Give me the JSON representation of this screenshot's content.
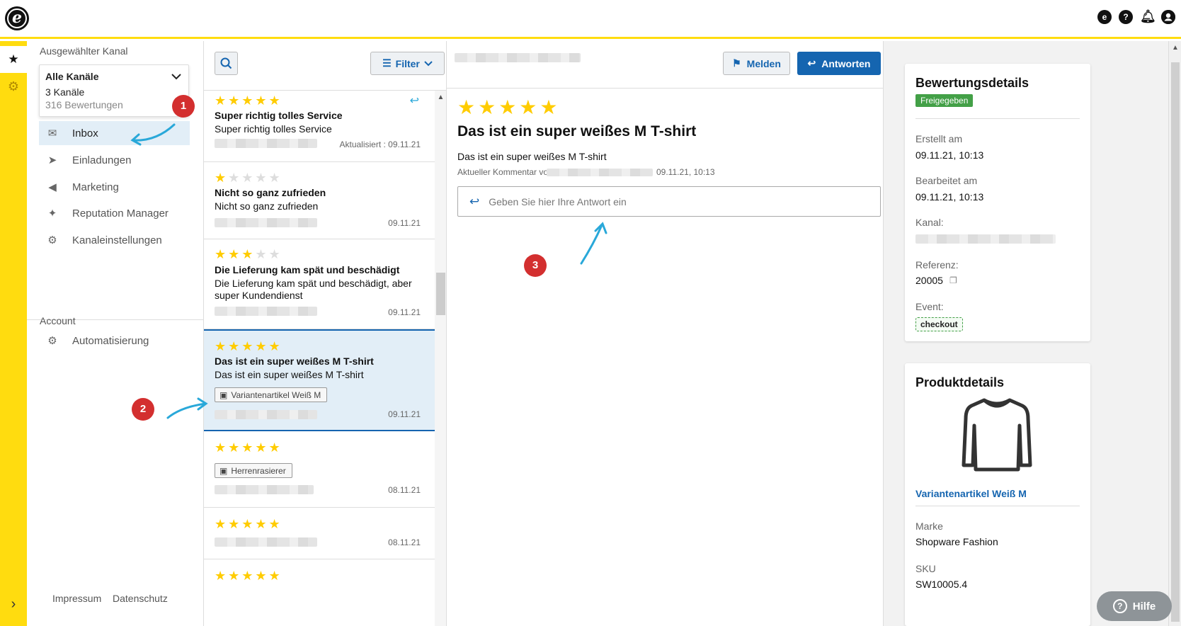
{
  "topbar": {
    "logo_char": "e",
    "icons": [
      "e-badge-icon",
      "help-icon",
      "bell-icon",
      "user-icon"
    ],
    "help_char": "?",
    "e_char": "e"
  },
  "rail": {
    "star_char": "★",
    "gear_char": "⚙",
    "chevron_char": "›"
  },
  "sidebar": {
    "channel_label": "Ausgewählter Kanal",
    "channel_select": {
      "title": "Alle Kanäle",
      "sub": "3 Kanäle",
      "count": "316 Bewertungen"
    },
    "nav": [
      {
        "label": "Inbox",
        "active": true
      },
      {
        "label": "Einladungen"
      },
      {
        "label": "Marketing"
      },
      {
        "label": "Reputation Manager"
      },
      {
        "label": "Kanaleinstellungen"
      }
    ],
    "account_label": "Account",
    "account_nav": [
      {
        "label": "Automatisierung"
      }
    ],
    "footer": {
      "impressum": "Impressum",
      "datenschutz": "Datenschutz"
    }
  },
  "list": {
    "filter_label": "Filter",
    "reviews": [
      {
        "rating": 5,
        "title": "Super richtig tolles Service",
        "text": "Super richtig tolles Service",
        "date": "Aktualisiert : 09.11.21",
        "replied": true
      },
      {
        "rating": 1,
        "title": "Nicht so ganz zufrieden",
        "text": "Nicht so ganz zufrieden",
        "date": "09.11.21"
      },
      {
        "rating": 3,
        "title": "Die Lieferung kam spät und beschädigt",
        "text": "Die Lieferung kam spät und beschädigt, aber super Kundendienst",
        "date": "09.11.21"
      },
      {
        "rating": 5,
        "title": "Das ist ein super weißes M T-shirt",
        "text": "Das ist ein super weißes M T-shirt",
        "tag": "Variantenartikel Weiß M",
        "date": "09.11.21",
        "selected": true
      },
      {
        "rating": 5,
        "tag": "Herrenrasierer",
        "date": "08.11.21"
      },
      {
        "rating": 5,
        "date": "08.11.21"
      },
      {
        "rating": 5
      }
    ]
  },
  "detail": {
    "melden_label": "Melden",
    "antworten_label": "Antworten",
    "rating": 5,
    "title": "Das ist ein super weißes M T-shirt",
    "body": "Das ist ein super weißes M T-shirt",
    "meta_prefix": "Aktueller Kommentar von",
    "meta_date": "09.11.21, 10:13",
    "reply_placeholder": "Geben Sie hier Ihre Antwort ein"
  },
  "review_details": {
    "title": "Bewertungsdetails",
    "status": "Freigegeben",
    "created_label": "Erstellt am",
    "created_value": "09.11.21, 10:13",
    "edited_label": "Bearbeitet am",
    "edited_value": "09.11.21, 10:13",
    "channel_label": "Kanal:",
    "reference_label": "Referenz:",
    "reference_value": "20005",
    "event_label": "Event:",
    "event_value": "checkout"
  },
  "product_details": {
    "title": "Produktdetails",
    "product_name": "Variantenartikel Weiß M",
    "brand_label": "Marke",
    "brand_value": "Shopware Fashion",
    "sku_label": "SKU",
    "sku_value": "SW10005.4"
  },
  "help_button": {
    "label": "Hilfe",
    "char": "?"
  },
  "annotations": {
    "markers": [
      "1",
      "2",
      "3"
    ]
  },
  "colors": {
    "accent_yellow": "#ffdc0f",
    "primary_blue": "#1565b0",
    "star": "#ffcc00",
    "marker_red": "#d32f2f",
    "arrow_cyan": "#29a8d9",
    "status_green": "#43a047"
  }
}
